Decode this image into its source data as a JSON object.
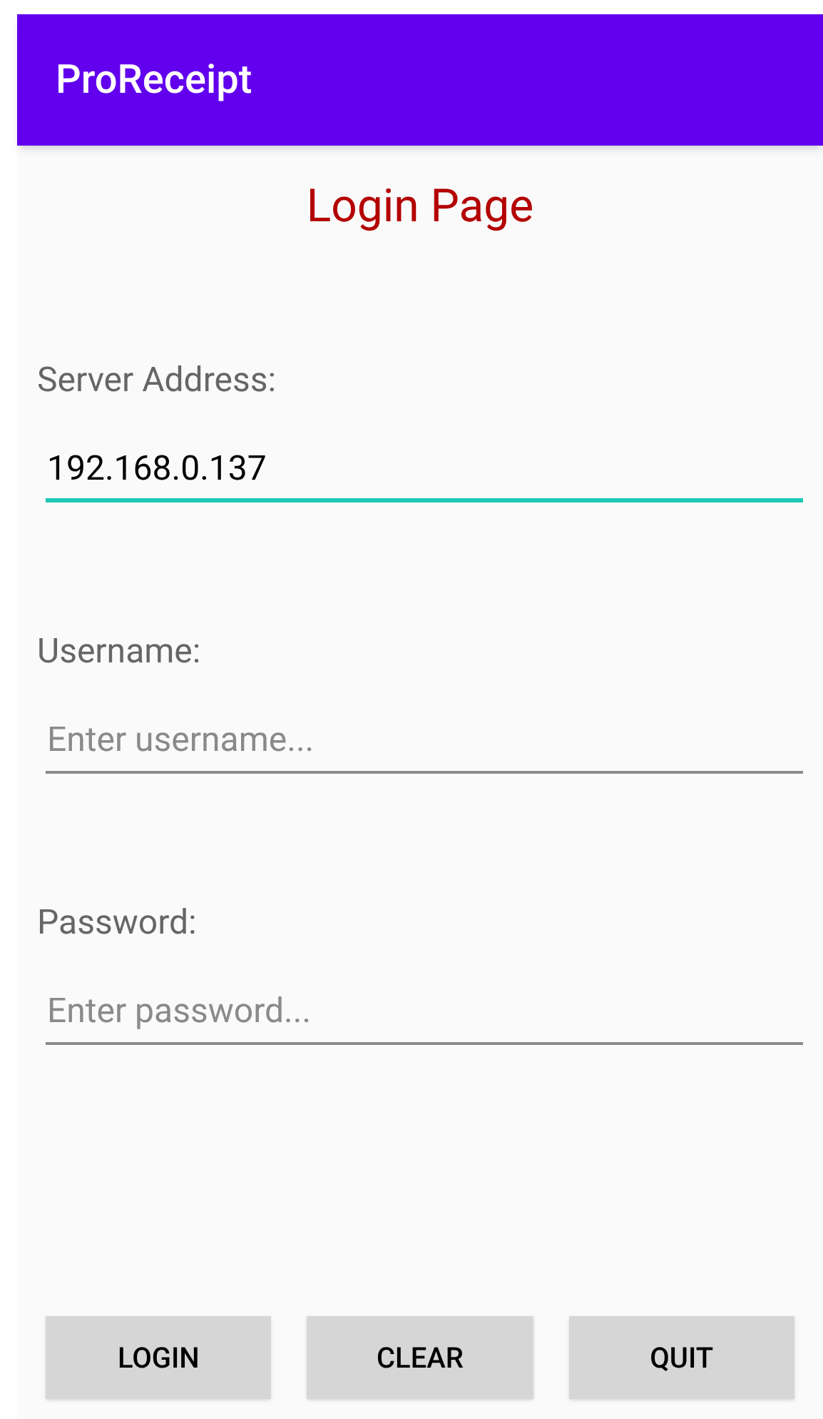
{
  "app_bar": {
    "title": "ProReceipt"
  },
  "heading": "Login Page",
  "fields": [
    {
      "label": "Server Address:",
      "value": "192.168.0.137",
      "focused": true
    },
    {
      "label": "Username:",
      "placeholder": "Enter username...",
      "focused": false
    },
    {
      "label": "Password:",
      "placeholder": "Enter password...",
      "focused": false
    }
  ],
  "buttons": [
    "LOGIN",
    "CLEAR",
    "QUIT"
  ]
}
